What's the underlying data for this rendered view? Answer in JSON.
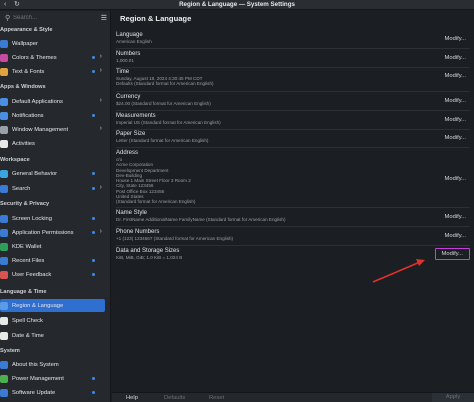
{
  "window": {
    "title": "Region & Language — System Settings",
    "back_icon": "back-arrow-icon",
    "history_icon": "refresh-icon"
  },
  "sidebar": {
    "search_placeholder": "Search...",
    "sections": [
      {
        "title": "Appearance & Style"
      },
      {
        "title": "Apps & Windows"
      },
      {
        "title": "Workspace"
      },
      {
        "title": "Security & Privacy"
      },
      {
        "title": "Language & Time"
      },
      {
        "title": "System"
      }
    ],
    "items": [
      {
        "label": "Wallpaper",
        "color": "#3a7bd5"
      },
      {
        "label": "Colors & Themes",
        "color": "#c94aa3"
      },
      {
        "label": "Text & Fonts",
        "color": "#e0a43a"
      },
      {
        "label": "Default Applications",
        "color": "#4a90e2"
      },
      {
        "label": "Notifications",
        "color": "#4a90e2"
      },
      {
        "label": "Window Management",
        "color": "#9aa0a6"
      },
      {
        "label": "Activities",
        "color": "#e8e8e8"
      },
      {
        "label": "General Behavior",
        "color": "#3aa6e0"
      },
      {
        "label": "Search",
        "color": "#3a7bd5"
      },
      {
        "label": "Screen Locking",
        "color": "#3a7bd5"
      },
      {
        "label": "Application Permissions",
        "color": "#3a7bd5"
      },
      {
        "label": "KDE Wallet",
        "color": "#2e9e5b"
      },
      {
        "label": "Recent Files",
        "color": "#3a7bd5"
      },
      {
        "label": "User Feedback",
        "color": "#d9534f"
      },
      {
        "label": "Region & Language",
        "color": "#5a9be6"
      },
      {
        "label": "Spell Check",
        "color": "#e8e8e8"
      },
      {
        "label": "Date & Time",
        "color": "#e8e8e8"
      },
      {
        "label": "About this System",
        "color": "#3a7bd5"
      },
      {
        "label": "Power Management",
        "color": "#4caf50"
      },
      {
        "label": "Software Update",
        "color": "#3a7bd5"
      }
    ]
  },
  "main": {
    "title": "Region & Language",
    "modify_label": "Modify...",
    "rows": [
      {
        "label": "Language",
        "values": [
          "American English"
        ]
      },
      {
        "label": "Numbers",
        "values": [
          "1,000.01"
        ]
      },
      {
        "label": "Time",
        "values": [
          "Sunday, August 18, 2024 4:30:45 PM CDT",
          "Defaults (Standard format for American English)"
        ]
      },
      {
        "label": "Currency",
        "values": [
          "$24.00 (Standard format for American English)"
        ]
      },
      {
        "label": "Measurements",
        "values": [
          "Imperial US (Standard format for American English)"
        ]
      },
      {
        "label": "Paper Size",
        "values": [
          "Letter (Standard format for American English)"
        ]
      },
      {
        "label": "Address",
        "values": [
          "c/o",
          "Acme Corporation",
          "Development Department",
          "Dev-Building",
          "House 1 Main Street Floor 3 Room 2",
          "City, State 123456",
          "Post Office Box 123456",
          "United States",
          "(Standard format for American English)"
        ]
      },
      {
        "label": "Name Style",
        "values": [
          "Dr. FirstName AdditionalName FamilyName (Standard format for American English)"
        ]
      },
      {
        "label": "Phone Numbers",
        "values": [
          "+1 (123) 1234567 (Standard format for American English)"
        ]
      },
      {
        "label": "Data and Storage Sizes",
        "values": [
          "KiB, MiB, GiB; 1.0 KiB = 1,024 B"
        ]
      }
    ]
  },
  "footer": {
    "help": "Help",
    "defaults": "Defaults",
    "reset": "Reset",
    "apply": "Apply"
  }
}
